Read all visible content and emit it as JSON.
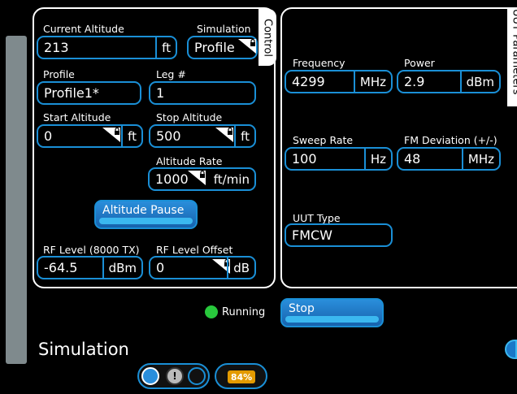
{
  "control_tab": "Control",
  "uut_tab": "UUT Parameters",
  "control": {
    "current_altitude": {
      "label": "Current Altitude",
      "value": "213",
      "unit": "ft"
    },
    "simulation": {
      "label": "Simulation",
      "value": "Profile"
    },
    "profile": {
      "label": "Profile",
      "value": "Profile1*"
    },
    "leg": {
      "label": "Leg #",
      "value": "1"
    },
    "start_altitude": {
      "label": "Start Altitude",
      "value": "0",
      "unit": "ft"
    },
    "stop_altitude": {
      "label": "Stop Altitude",
      "value": "500",
      "unit": "ft"
    },
    "altitude_rate": {
      "label": "Altitude Rate",
      "value": "1000",
      "unit": "ft/min"
    },
    "altitude_pause_label": "Altitude Pause",
    "rf_level": {
      "label": "RF Level (8000 TX)",
      "value": "-64.5",
      "unit": "dBm"
    },
    "rf_level_offset": {
      "label": "RF Level Offset",
      "value": "0",
      "unit": "dB"
    }
  },
  "uut": {
    "frequency": {
      "label": "Frequency",
      "value": "4299",
      "unit": "MHz"
    },
    "power": {
      "label": "Power",
      "value": "2.9",
      "unit": "dBm"
    },
    "sweep_rate": {
      "label": "Sweep Rate",
      "value": "100",
      "unit": "Hz"
    },
    "fm_deviation": {
      "label": "FM Deviation (+/-)",
      "value": "48",
      "unit": "MHz"
    },
    "uut_type": {
      "label": "UUT Type",
      "value": "FMCW"
    }
  },
  "status": {
    "text": "Running",
    "color": "#28c83c"
  },
  "stop_label": "Stop",
  "screen_title": "Simulation",
  "battery": {
    "percent_label": "84%",
    "level": 0.84
  },
  "accent_color": "#1a8fd6",
  "icons": [
    "lock-icon",
    "power-icon",
    "info-icon",
    "battery-icon",
    "collapse-icon"
  ]
}
